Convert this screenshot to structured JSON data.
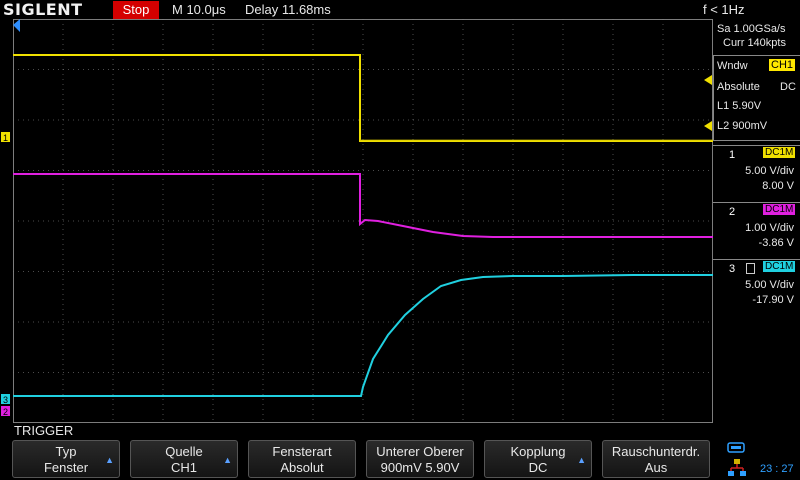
{
  "header": {
    "brand": "SIGLENT",
    "run_state": "Stop",
    "timebase": "M 10.0μs",
    "delay": "Delay 11.68ms",
    "frequency": "f < 1Hz"
  },
  "acquisition": {
    "sample_rate": "Sa 1.00GSa/s",
    "memory_depth": "Curr 140kpts"
  },
  "cursor_panel": {
    "window_label": "Wndw",
    "window_channel": "CH1",
    "mode": "Absolute",
    "coupling": "DC",
    "l1": "L1  5.90V",
    "l2": "L2  900mV"
  },
  "channels": [
    {
      "number": "1",
      "coupling": "DC1M",
      "scale": "5.00 V/div",
      "offset": "8.00 V",
      "color": "#f0e000"
    },
    {
      "number": "2",
      "coupling": "DC1M",
      "scale": "1.00 V/div",
      "offset": "-3.86 V",
      "color": "#e020e0"
    },
    {
      "number": "3",
      "coupling": "DC1M",
      "scale": "5.00 V/div",
      "offset": "-17.90 V",
      "color": "#20d0e0"
    }
  ],
  "menu": {
    "title": "TRIGGER",
    "buttons": [
      {
        "line1": "Typ",
        "line2": "Fenster"
      },
      {
        "line1": "Quelle",
        "line2": "CH1"
      },
      {
        "line1": "Fensterart",
        "line2": "Absolut"
      },
      {
        "line1": "Unterer Oberer",
        "line2": "900mV 5.90V"
      },
      {
        "line1": "Kopplung",
        "line2": "DC"
      },
      {
        "line1": "Rauschunterdr.",
        "line2": "Aus"
      }
    ]
  },
  "status": {
    "clock": "23 : 27"
  },
  "colors": {
    "ch1": "#f0e000",
    "ch2": "#e020e0",
    "ch3": "#20d0e0",
    "stop": "#d40000",
    "trigger_marker": "#2f8fff"
  }
}
